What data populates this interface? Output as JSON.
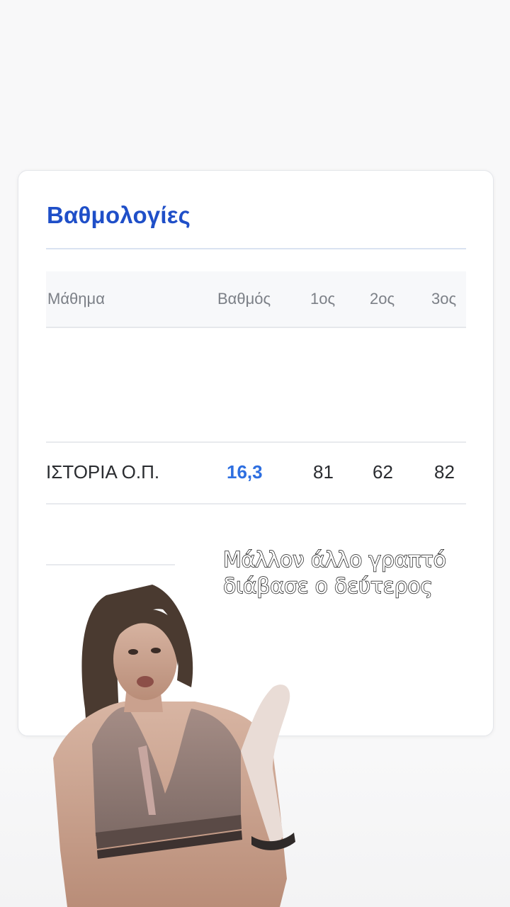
{
  "card": {
    "title": "Βαθμολογίες"
  },
  "table": {
    "headers": {
      "subject": "Μάθημα",
      "grade": "Βαθμός",
      "first": "1ος",
      "second": "2ος",
      "third": "3ος"
    },
    "rows": [
      {
        "subject": "ΙΣΤΟΡΙΑ Ο.Π.",
        "grade": "16,3",
        "first": "81",
        "second": "62",
        "third": "82"
      }
    ]
  },
  "overlay": {
    "line1": "Μάλλον άλλο γραπτό",
    "line2": "διάβασε ο δεύτερος"
  },
  "colors": {
    "title": "#1f4fc8",
    "grade": "#2e6fe0",
    "header_text": "#7c8087",
    "body_text": "#2a2c30"
  },
  "icons": {
    "person": "person-cutout-icon"
  }
}
